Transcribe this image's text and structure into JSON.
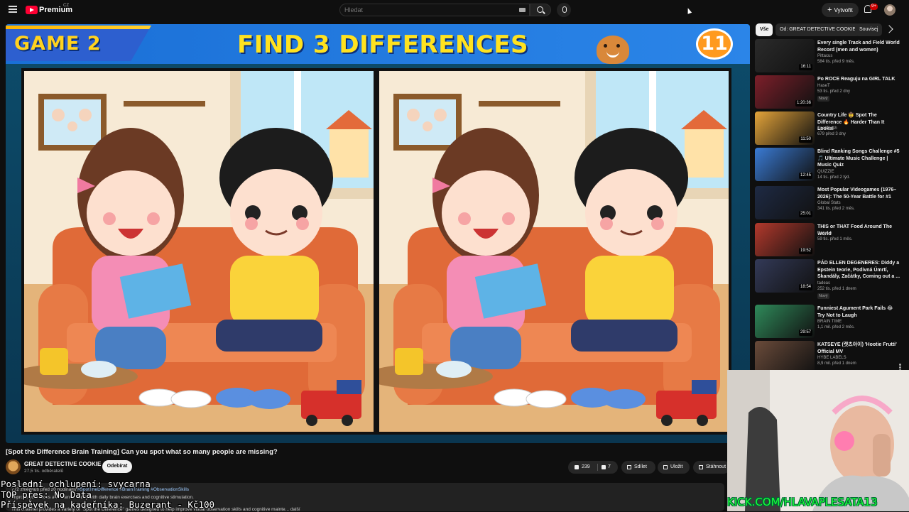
{
  "topbar": {
    "logo_text": "Premium",
    "logo_country": "CZ",
    "search_placeholder": "Hledat",
    "create_label": "Vytvořit",
    "notifications_badge": "9+"
  },
  "player": {
    "game_label": "GAME  2",
    "headline": "FIND 3 DIFFERENCES",
    "timer": "11"
  },
  "video": {
    "title": "[Spot the Difference Brain Training] Can you spot what so many people are missing?",
    "channel": "GREAT DETECTIVE COOKIE",
    "subscribers": "27,5 tis. odběratelů",
    "subscribe_label": "Odebírat",
    "likes": "239",
    "dislikes": "7",
    "share_label": "Sdílet",
    "save_label": "Uložit",
    "download_label": "Stáhnout",
    "desc_meta": "772 zhlédnutí  před 20 hodinami",
    "desc_tags": "#SpotTheDifference #BrainTraining #ObservationSkills",
    "desc_line2": "Improve your focus and mental clarity with daily brain exercises and cognitive stimulation.",
    "desc_line3": "This channel provides a variety of \"Spot the Difference\" games designed to help improve visual observation skills and cognitive mainte... další"
  },
  "overlay": {
    "line1": "Poslední ochlupení: svycarna",
    "line2": "TOP přes: No Data",
    "line3": "Příspěvek na kadeřníka: Buzerant - Kč100"
  },
  "sidebar": {
    "chips": [
      "Vše",
      "Od: GREAT DETECTIVE COOKIE",
      "Souvisej"
    ],
    "items": [
      {
        "title": "Every single Track and Field World Record (men and women)",
        "channel": "Pittacus",
        "meta": "584 tis.  před 9 měs.",
        "duration": "16:11",
        "new": ""
      },
      {
        "title": "Po ROCE Reaguju na GIRL TALK",
        "channel": "HaseT",
        "meta": "53 tis.  před 2 dny",
        "duration": "1:20:36",
        "new": "Nový"
      },
      {
        "title": "Country Life 🤠 Spot The Difference 🔥 Harder Than It Looks!",
        "channel": "SpotClash",
        "meta": "679  před 3 dny",
        "duration": "11:50",
        "new": ""
      },
      {
        "title": "Blind Ranking Songs Challenge #5 🎵 Ultimate Music Challenge | Music Quiz",
        "channel": "QUIZZIE",
        "meta": "14 tis.  před 2 týd.",
        "duration": "12:45",
        "new": ""
      },
      {
        "title": "Most Popular Videogames (1976–2026): The 50-Year Battle for #1",
        "channel": "Global Stats",
        "meta": "341 tis.  před 2 měs.",
        "duration": "25:01",
        "new": ""
      },
      {
        "title": "THIS or THAT Food Around The World",
        "channel": "Delphie",
        "meta": "59 tis.  před 1 měs.",
        "duration": "19:52",
        "new": ""
      },
      {
        "title": "PÁD ELLEN DEGENERES: Diddy a Epstein teorie, Podivná Úmrtí, Skandály, Začátky, Coming out a ...",
        "channel": "tadeas",
        "meta": "252 tis.  před 1 dnem",
        "duration": "18:54",
        "new": "Nový"
      },
      {
        "title": "Funniest Agument Park Fails 😂 Try Not to Laugh",
        "channel": "BRAIN TIME",
        "meta": "1,1 mil.  před 2 měs.",
        "duration": "29:57",
        "new": ""
      },
      {
        "title": "KATSEYE (캣츠아이) 'Hootie Frutti' Official MV",
        "channel": "HYBE LABELS",
        "meta": "8,9 mil.  před 1 dnem",
        "duration": "",
        "new": ""
      }
    ]
  },
  "webcam": {
    "caption": "KICK.COM/HLAVAPLESATA13"
  },
  "colors": {
    "accent_red": "#ff0033",
    "background": "#0f0f0f",
    "headline_yellow": "#ffe21f",
    "webcam_green": "#19ff3b"
  }
}
